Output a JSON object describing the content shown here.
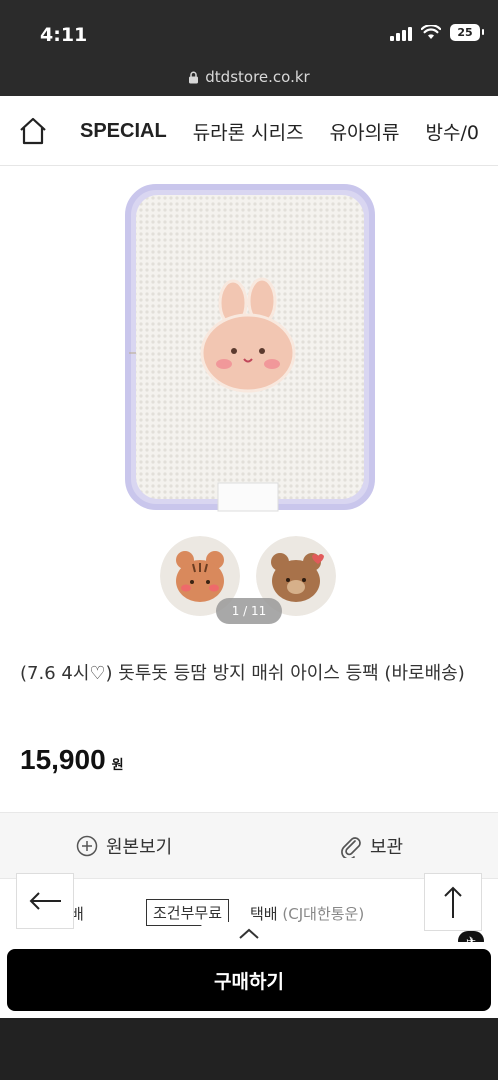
{
  "status": {
    "time": "4:11",
    "battery": "25"
  },
  "url": {
    "domain": "dtdstore.co.kr"
  },
  "nav": {
    "tabs": [
      "SPECIAL",
      "듀라론 시리즈",
      "유아의류",
      "방수/0"
    ]
  },
  "gallery": {
    "counter": "1 / 11"
  },
  "product": {
    "title": "(7.6 4시♡) 돗투돗 등땀 방지 매쉬 아이스 등팩 (바로배송)",
    "price": "15,900",
    "price_unit": "원"
  },
  "actions": {
    "original": "원본보기",
    "save": "보관"
  },
  "shipping": {
    "left_fragment": "배",
    "badge": "조건부무료",
    "method": "택배",
    "carrier": "(CJ대한통운)"
  },
  "buy": {
    "label": "구매하기"
  },
  "colors": {
    "accent": "#000000",
    "status_bg": "#2b2b2b",
    "pad_trim": "#c9c6ec",
    "bunny": "#f2c6b2"
  }
}
